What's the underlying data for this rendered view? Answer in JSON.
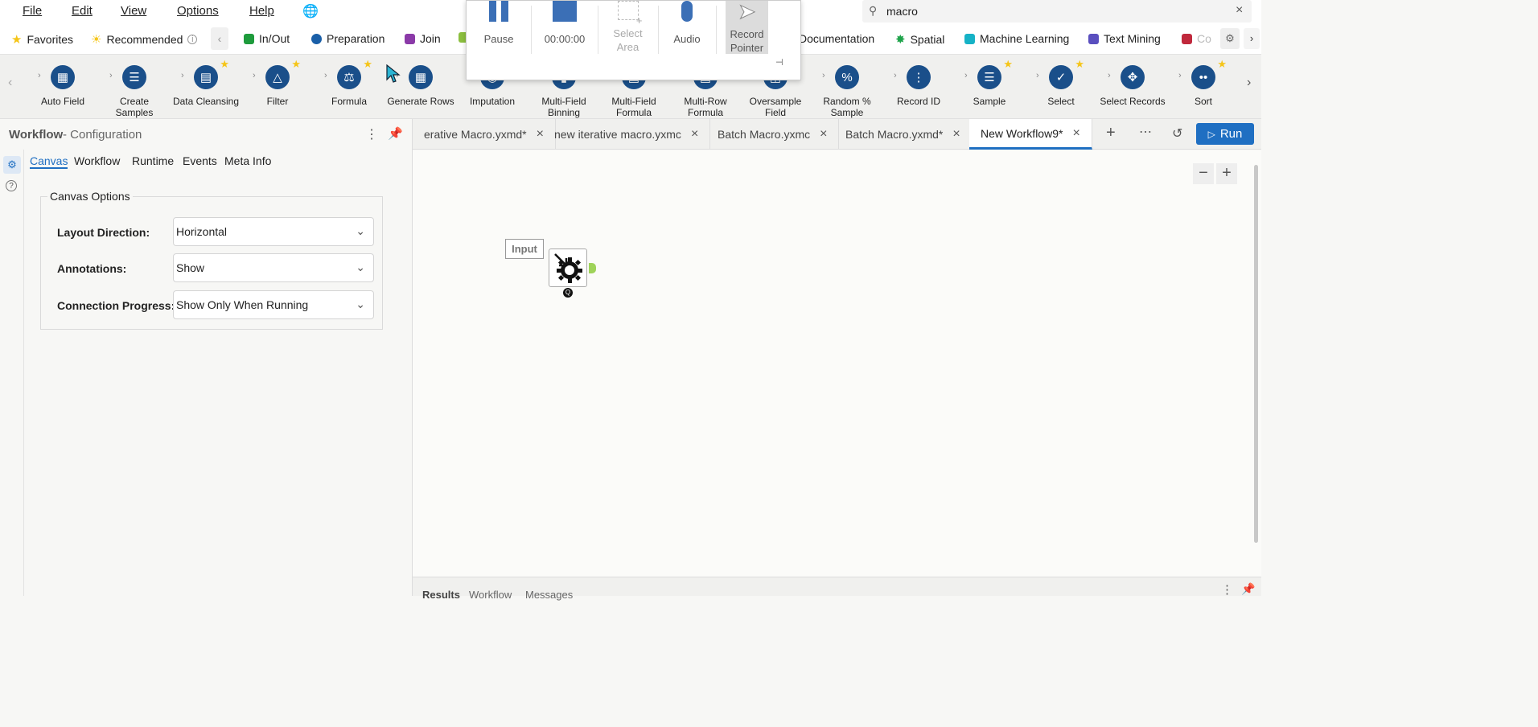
{
  "menu": {
    "file": "File",
    "edit": "Edit",
    "view": "View",
    "options": "Options",
    "help": "Help"
  },
  "search": {
    "value": "macro"
  },
  "categories": [
    {
      "label": "Favorites",
      "color": "#f5c518"
    },
    {
      "label": "Recommended",
      "color": "#f5c518"
    },
    {
      "label": "In/Out",
      "color": "#1e9b3c"
    },
    {
      "label": "Preparation",
      "color": "#1a5fa8"
    },
    {
      "label": "Join",
      "color": "#8b3aa8"
    },
    {
      "label": "Documentation",
      "color": ""
    },
    {
      "label": "Spatial",
      "color": "#1ea34a"
    },
    {
      "label": "Machine Learning",
      "color": "#16b2c6"
    },
    {
      "label": "Text Mining",
      "color": "#5a4fbf"
    },
    {
      "label": "Co",
      "color": "#c0283c"
    }
  ],
  "tools": [
    {
      "label": "Auto Field",
      "icon": "auto-field-icon",
      "star": false
    },
    {
      "label": "Create Samples",
      "icon": "create-samples-icon",
      "star": false
    },
    {
      "label": "Data Cleansing",
      "icon": "data-cleansing-icon",
      "star": true
    },
    {
      "label": "Filter",
      "icon": "filter-icon",
      "star": true
    },
    {
      "label": "Formula",
      "icon": "formula-icon",
      "star": true
    },
    {
      "label": "Generate Rows",
      "icon": "generate-rows-icon",
      "star": false
    },
    {
      "label": "Imputation",
      "icon": "imputation-icon",
      "star": false
    },
    {
      "label": "Multi-Field Binning",
      "icon": "multi-field-binning-icon",
      "star": false
    },
    {
      "label": "Multi-Field Formula",
      "icon": "multi-field-formula-icon",
      "star": false
    },
    {
      "label": "Multi-Row Formula",
      "icon": "multi-row-formula-icon",
      "star": false
    },
    {
      "label": "Oversample Field",
      "icon": "oversample-field-icon",
      "star": false
    },
    {
      "label": "Random % Sample",
      "icon": "random-sample-icon",
      "star": false
    },
    {
      "label": "Record ID",
      "icon": "record-id-icon",
      "star": false
    },
    {
      "label": "Sample",
      "icon": "sample-icon",
      "star": true
    },
    {
      "label": "Select",
      "icon": "select-icon",
      "star": true
    },
    {
      "label": "Select Records",
      "icon": "select-records-icon",
      "star": false
    },
    {
      "label": "Sort",
      "icon": "sort-icon",
      "star": true
    }
  ],
  "recorder": {
    "pause": "Pause",
    "time": "00:00:00",
    "select_area": "Select Area",
    "audio": "Audio",
    "record_pointer": "Record Pointer"
  },
  "left_panel": {
    "title": "Workflow",
    "subtitle": "- Configuration",
    "tabs": [
      "Canvas",
      "Workflow",
      "Runtime",
      "Events",
      "Meta Info"
    ],
    "group_title": "Canvas Options",
    "options": [
      {
        "label": "Layout Direction:",
        "value": "Horizontal"
      },
      {
        "label": "Annotations:",
        "value": "Show"
      },
      {
        "label": "Connection Progress:",
        "value": "Show Only When Running"
      }
    ]
  },
  "doc_tabs": [
    {
      "label": "erative Macro.yxmd*",
      "active": false
    },
    {
      "label": "new iterative macro.yxmc",
      "active": false
    },
    {
      "label": "Batch Macro.yxmc",
      "active": false
    },
    {
      "label": "Batch Macro.yxmd*",
      "active": false
    },
    {
      "label": "New Workflow9*",
      "active": true
    }
  ],
  "run_label": "Run",
  "canvas": {
    "input_label": "Input"
  },
  "results_tabs": [
    "Results",
    "Workflow",
    "Messages"
  ],
  "colors": {
    "accent": "#1f6fc2",
    "tool_icon": "#1a4f8a",
    "star": "#f5c518"
  }
}
